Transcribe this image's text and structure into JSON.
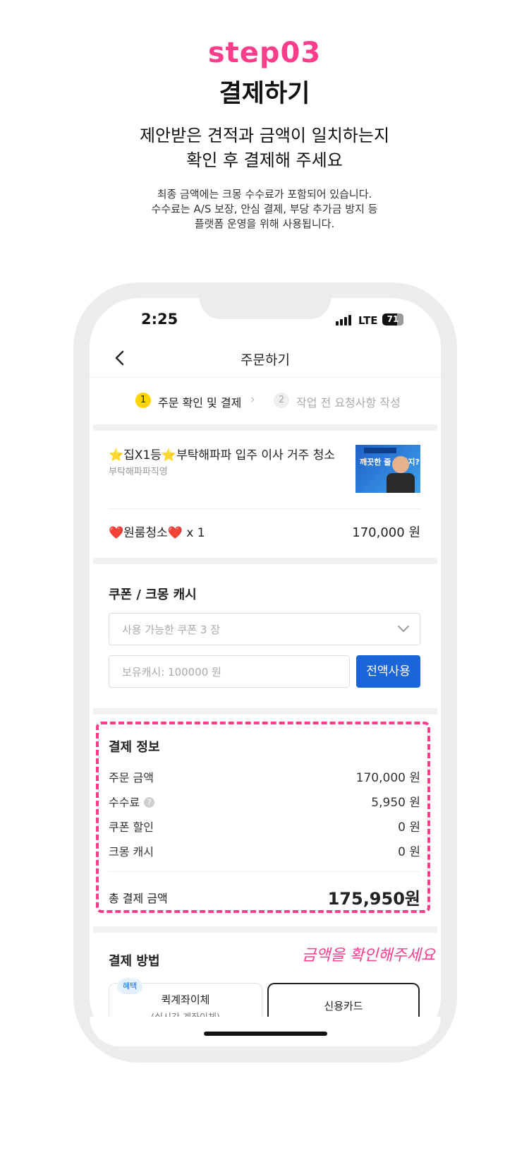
{
  "header": {
    "step": "step03",
    "title": "결제하기",
    "headline_lines": [
      "제안받은 견적과 금액이 일치하는지",
      "확인 후 결제해 주세요"
    ],
    "note_lines": [
      "최종 금액에는 크몽 수수료가 포함되어 있습니다.",
      "수수료는 A/S 보장, 안심 결제, 부당 추가금 방지 등",
      "플랫폼 운영을 위해 사용됩니다."
    ]
  },
  "status_bar": {
    "time": "2:25",
    "network": "LTE",
    "battery": "71",
    "battery_level": 0.71
  },
  "nav": {
    "title": "주문하기"
  },
  "stepper": [
    {
      "num": "1",
      "label": "주문 확인 및 결제"
    },
    {
      "num": "2",
      "label": "작업 전 요청사항 작성"
    }
  ],
  "product": {
    "title": "⭐집X1등⭐부탁해파파 입주 이사 거주 청소",
    "seller": "부탁해파파직영",
    "thumbnail_text": "깨끗한 줄 알았지?",
    "option_label": "❤️원룸청소❤️ x 1",
    "option_price": "170,000 원"
  },
  "coupon": {
    "title": "쿠폰 / 크몽 캐시",
    "select_placeholder": "사용 가능한 쿠폰 3 장",
    "cash_placeholder": "보유캐시: 100000 원",
    "use_all_label": "전액사용"
  },
  "payment_info": {
    "title": "결제 정보",
    "rows": [
      {
        "label": "주문 금액",
        "value": "170,000 원"
      },
      {
        "label": "수수료",
        "value": "5,950 원"
      },
      {
        "label": "쿠폰 할인",
        "value": "0 원"
      },
      {
        "label": "크몽 캐시",
        "value": "0 원"
      }
    ],
    "total_label": "총 결제 금액",
    "total_value": "175,950원"
  },
  "annotation": "금액을 확인해주세요",
  "payment_method": {
    "title": "결제 방법",
    "badge": "혜택",
    "options": [
      {
        "label": "퀵계좌이체",
        "sub": "(실시간 계좌이체)"
      },
      {
        "label": "신용카드"
      }
    ]
  },
  "colors": {
    "accent": "#ff3d8b",
    "primary_button": "#1a66d8",
    "step_active": "#ffd400"
  }
}
